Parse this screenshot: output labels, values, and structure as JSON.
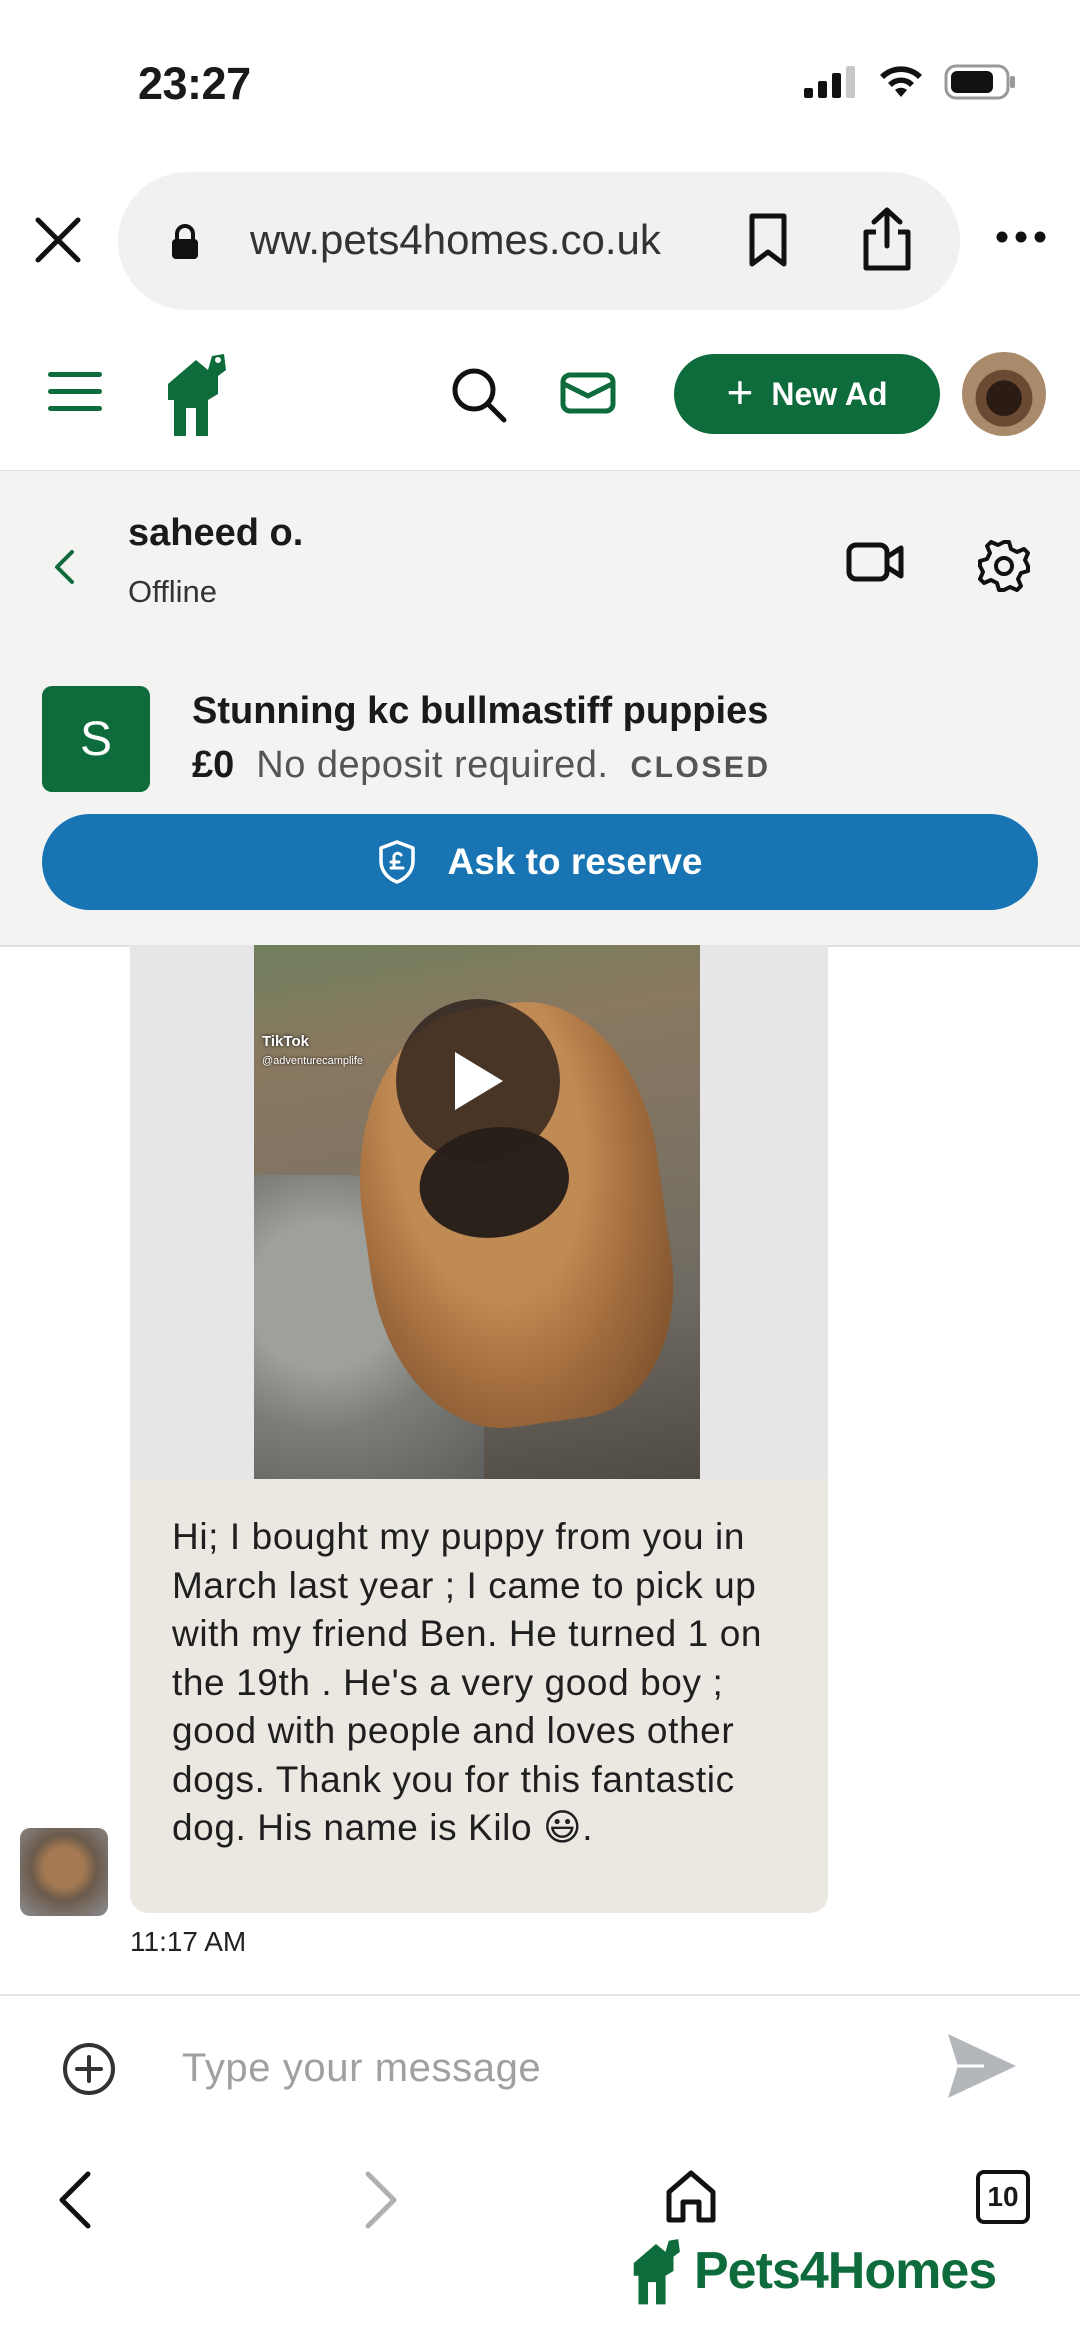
{
  "status_bar": {
    "time": "23:27"
  },
  "browser": {
    "url": "ww.pets4homes.co.uk",
    "close_icon": "close-icon",
    "more_icon": "more-icon"
  },
  "header": {
    "new_ad_label": "New Ad",
    "brand_color": "#0e6b3b"
  },
  "conversation": {
    "name": "saheed o.",
    "status": "Offline"
  },
  "listing": {
    "avatar_letter": "S",
    "title": "Stunning kc bullmastiff puppies",
    "price": "£0",
    "deposit": "No deposit required.",
    "state": "CLOSED",
    "reserve_label": "Ask to reserve",
    "reserve_color": "#1874b3"
  },
  "message": {
    "video_tag": "TikTok",
    "video_user": "@adventurecamplife",
    "text": "Hi; I bought my puppy from you in March last year ; I came to pick up with my friend Ben. He turned 1 on the 19th . He's a very good boy ; good with people and loves other dogs. Thank you for this fantastic dog. His name is Kilo 😃.",
    "time": "11:17 AM"
  },
  "composer": {
    "placeholder": "Type your message"
  },
  "bottom_nav": {
    "tab_count": "10",
    "brand_name": "Pets4Homes"
  }
}
